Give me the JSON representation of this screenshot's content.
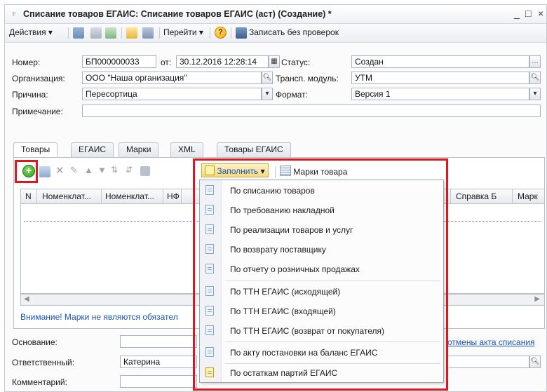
{
  "window": {
    "title": "Списание товаров ЕГАИС: Списание товаров ЕГАИС (аст) (Создание) *",
    "buttons": [
      "_",
      "□",
      "×"
    ]
  },
  "toolbar": {
    "actions_label": "Действия",
    "goto_label": "Перейти",
    "help_label": "?",
    "save_nocheck_label": "Записать без проверок"
  },
  "header": {
    "number_label": "Номер:",
    "number_value": "БП000000033",
    "from_label": "от:",
    "date_value": "30.12.2016 12:28:14",
    "status_label": "Статус:",
    "status_value": "Создан",
    "org_label": "Организация:",
    "org_value": "ООО \"Наша организация\"",
    "transport_label": "Трансп. модуль:",
    "transport_value": "УТМ",
    "reason_label": "Причина:",
    "reason_value": "Пересортица",
    "format_label": "Формат:",
    "format_value": "Версия 1",
    "note_label": "Примечание:",
    "note_value": ""
  },
  "tabs": [
    "Товары",
    "ЕГАИС",
    "Марки",
    "XML",
    "Товары ЕГАИС"
  ],
  "table_toolbar": {
    "fill_label": "Заполнить",
    "marks_label": "Марки товара"
  },
  "grid": {
    "columns": [
      "N",
      "Номенклат...",
      "Номенклат...",
      "НФ",
      "Справка Б",
      "Марк"
    ]
  },
  "warning_text": "Внимание! Марки не являются обязател",
  "footer": {
    "basis_label": "Основание:",
    "cancel_link": "отмены акта списания",
    "responsible_label": "Ответственный:",
    "responsible_value": "Катерина",
    "comment_label": "Комментарий:"
  },
  "fill_menu": {
    "items": [
      "По списанию товаров",
      "По требованию накладной",
      "По реализации товаров и услуг",
      "По возврату поставщику",
      "По отчету о розничных продажах",
      "По ТТН ЕГАИС (исходящей)",
      "По ТТН ЕГАИС (входящей)",
      "По ТТН ЕГАИС (возврат от покупателя)",
      "По акту постановки на баланс ЕГАИС",
      "По остаткам партий ЕГАИС"
    ]
  },
  "colors": {
    "highlight": "#e0161e",
    "link": "#1c55b5",
    "add_button": "#3fae2a"
  }
}
